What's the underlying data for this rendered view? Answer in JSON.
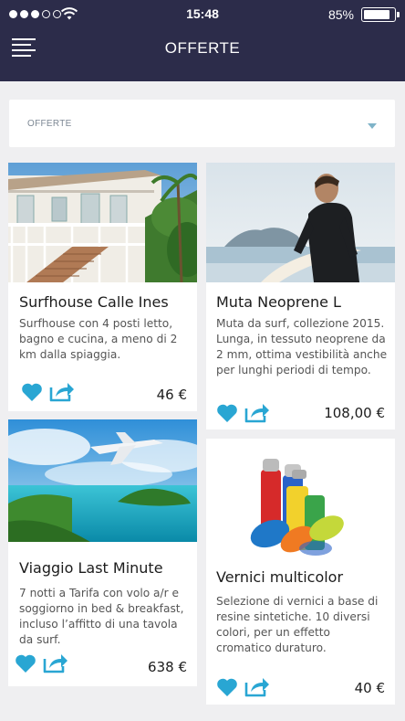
{
  "status": {
    "time": "15:48",
    "battery": "85%",
    "battery_level": 0.85,
    "signal_bars": 3,
    "signal_total": 5
  },
  "header": {
    "title": "OFFERTE",
    "menu_icon": "hamburger-menu-icon"
  },
  "filter": {
    "selected": "OFFERTE",
    "icon": "chevron-down-icon"
  },
  "colors": {
    "header": "#2c2c4a",
    "accent": "#29a6d3",
    "background": "#efeff1"
  },
  "cards": [
    {
      "title": "Surfhouse Calle Ines",
      "desc": "Surfhouse con 4 posti letto, bagno e cucina, a meno di 2 km dalla spiaggia.",
      "price": "46 €",
      "image": "white colonial house with balcony and palm trees"
    },
    {
      "title": "Muta Neoprene L",
      "desc": "Muta da surf, collezione 2015. Lunga, in tessuto neoprene da 2 mm, ottima vestibilità anche per lunghi periodi di tempo.",
      "price": "108,00 €",
      "image": "surfer in black wetsuit holding surfboard"
    },
    {
      "title": "Viaggio Last Minute",
      "desc": "7 notti a Tarifa con volo a/r e soggiorno in bed & breakfast, incluso l’affitto di una tavola da surf.",
      "price": "638 €",
      "image": "airplane flying over tropical island"
    },
    {
      "title": "Vernici multicolor",
      "desc": "Selezione di vernici a base di resine sintetiche. 10 diversi colori, per un effetto cromatico duraturo.",
      "price": "40 €",
      "image": "colorful spray paint cans"
    }
  ]
}
